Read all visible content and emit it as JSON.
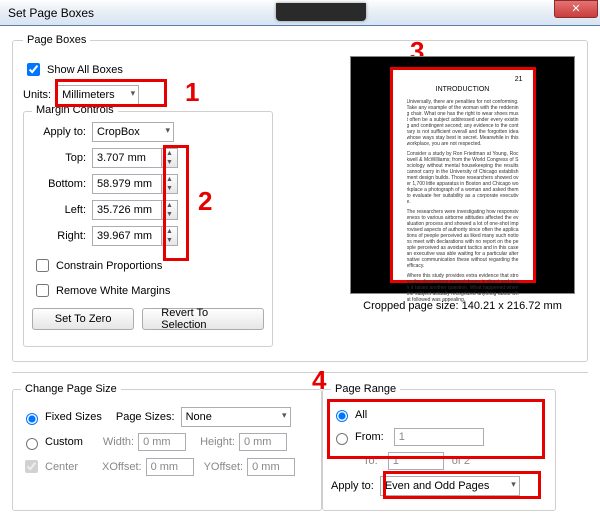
{
  "window": {
    "title": "Set Page Boxes"
  },
  "markers": {
    "m1": "1",
    "m2": "2",
    "m3": "3",
    "m4": "4"
  },
  "pageboxes": {
    "legend": "Page Boxes",
    "show_all": "Show All Boxes",
    "units_label": "Units:",
    "units_value": "Millimeters",
    "margins": {
      "legend": "Margin Controls",
      "apply_to_label": "Apply to:",
      "apply_to_value": "CropBox",
      "top_label": "Top:",
      "top_value": "3.707 mm",
      "bottom_label": "Bottom:",
      "bottom_value": "58.979 mm",
      "left_label": "Left:",
      "left_value": "35.726 mm",
      "right_label": "Right:",
      "right_value": "39.967 mm",
      "constrain": "Constrain Proportions",
      "remove_white": "Remove White Margins",
      "set_zero": "Set To Zero",
      "revert": "Revert To Selection"
    },
    "preview": {
      "page_heading": "INTRODUCTION",
      "page_number": "21",
      "caption": "Cropped page size: 140.21 x 216.72 mm"
    }
  },
  "change": {
    "legend": "Change Page Size",
    "fixed": "Fixed Sizes",
    "custom": "Custom",
    "center": "Center",
    "page_sizes_label": "Page Sizes:",
    "page_sizes_value": "None",
    "width_label": "Width:",
    "width_value": "0 mm",
    "height_label": "Height:",
    "height_value": "0 mm",
    "xoff_label": "XOffset:",
    "xoff_value": "0 mm",
    "yoff_label": "YOffset:",
    "yoff_value": "0 mm"
  },
  "range": {
    "legend": "Page Range",
    "all": "All",
    "from": "From:",
    "from_value": "1",
    "to": "To:",
    "to_value": "1",
    "of": "of 2",
    "apply_to_label": "Apply to:",
    "apply_to_value": "Even and Odd Pages"
  }
}
